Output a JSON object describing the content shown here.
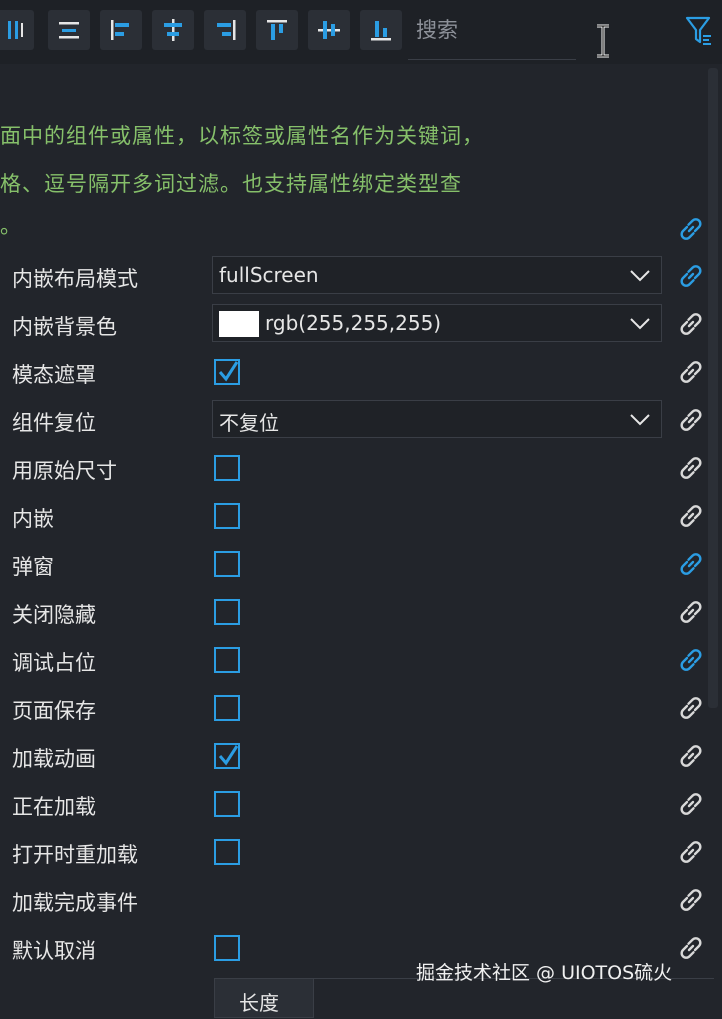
{
  "colors": {
    "background": "#22252b",
    "accent_blue": "#2b9de3",
    "hint_green": "#86c06a",
    "link_inactive": "#d8d8d8"
  },
  "toolbar": {
    "buttons": [
      {
        "icon": "align-columns-icon"
      },
      {
        "icon": "align-rows-icon"
      },
      {
        "icon": "align-left-icon"
      },
      {
        "icon": "align-center-horizontal-icon"
      },
      {
        "icon": "align-right-icon"
      },
      {
        "icon": "align-top-icon"
      },
      {
        "icon": "align-middle-vertical-icon"
      },
      {
        "icon": "align-bottom-icon"
      }
    ],
    "search_placeholder": "搜索",
    "filter_icon": "filter-icon"
  },
  "hint": {
    "line1": "面中的组件或属性，以标签或属性名作为关键词，",
    "line2": "格、逗号隔开多词过滤。也支持属性绑定类型查",
    "line3": "。"
  },
  "properties": [
    {
      "label": "内嵌布局模式",
      "type": "select",
      "value": "fullScreen",
      "link_active": true
    },
    {
      "label": "内嵌背景色",
      "type": "color",
      "value": "rgb(255,255,255)",
      "link_active": false
    },
    {
      "label": "模态遮罩",
      "type": "checkbox",
      "checked": true,
      "link_active": false
    },
    {
      "label": "组件复位",
      "type": "select",
      "value": "不复位",
      "link_active": false
    },
    {
      "label": "用原始尺寸",
      "type": "checkbox",
      "checked": false,
      "link_active": false
    },
    {
      "label": "内嵌",
      "type": "checkbox",
      "checked": false,
      "link_active": false
    },
    {
      "label": "弹窗",
      "type": "checkbox",
      "checked": false,
      "link_active": true
    },
    {
      "label": "关闭隐藏",
      "type": "checkbox",
      "checked": false,
      "link_active": false
    },
    {
      "label": "调试占位",
      "type": "checkbox",
      "checked": false,
      "link_active": true
    },
    {
      "label": "页面保存",
      "type": "checkbox",
      "checked": false,
      "link_active": false
    },
    {
      "label": "加载动画",
      "type": "checkbox",
      "checked": true,
      "link_active": false
    },
    {
      "label": "正在加载",
      "type": "checkbox",
      "checked": false,
      "link_active": false
    },
    {
      "label": "打开时重加载",
      "type": "checkbox",
      "checked": false,
      "link_active": false
    },
    {
      "label": "加载完成事件",
      "type": "none",
      "link_active": false
    },
    {
      "label": "默认取消",
      "type": "checkbox",
      "checked": false,
      "link_active": false
    }
  ],
  "table": {
    "header_length": "长度"
  },
  "watermark": "掘金技术社区 @ UIOTOS硫火"
}
